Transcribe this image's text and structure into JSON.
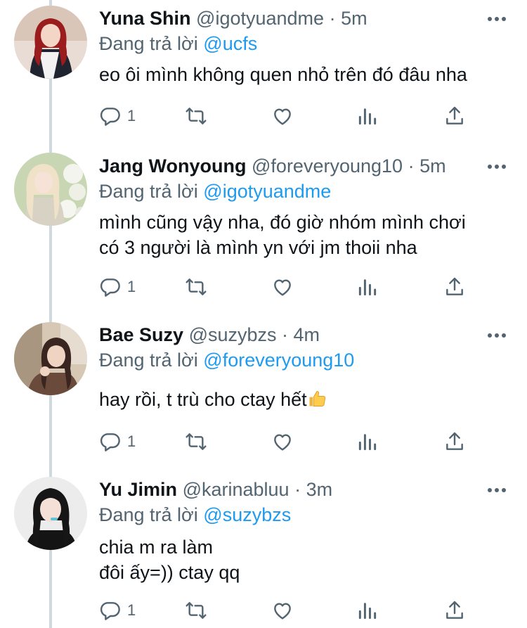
{
  "reply_prefix": "Đang trả lời",
  "colors": {
    "accent": "#1d9bf0",
    "muted": "#536471",
    "text": "#0f1419",
    "thread_line": "#cfd9de"
  },
  "tweets": [
    {
      "name": "Yuna Shin",
      "handle": "@igotyuandme",
      "time": "· 5m",
      "reply_to": "@ucfs",
      "lines": [
        "eo ôi mình không quen nhỏ trên đó đâu nha"
      ],
      "reply_count": "1"
    },
    {
      "name": "Jang Wonyoung",
      "handle": "@foreveryoung10",
      "time": "· 5m",
      "reply_to": "@igotyuandme",
      "lines": [
        "mình cũng vậy nha, đó giờ nhóm mình chơi",
        "có 3 người là mình yn với jm thoii nha"
      ],
      "reply_count": "1"
    },
    {
      "name": "Bae Suzy",
      "handle": "@suzybzs",
      "time": "· 4m",
      "reply_to": "@foreveryoung10",
      "lines": [
        "hay rồi, t trù cho ctay hết"
      ],
      "emoji": "thumbs-up",
      "reply_count": "1"
    },
    {
      "name": "Yu Jimin",
      "handle": "@karinabluu",
      "time": "· 3m",
      "reply_to": "@suzybzs",
      "lines": [
        "chia m ra làm",
        "đôi ấy=)) ctay qq"
      ],
      "reply_count": "1"
    }
  ],
  "action_icons": [
    "reply-icon",
    "retweet-icon",
    "like-icon",
    "analytics-icon",
    "share-icon"
  ]
}
